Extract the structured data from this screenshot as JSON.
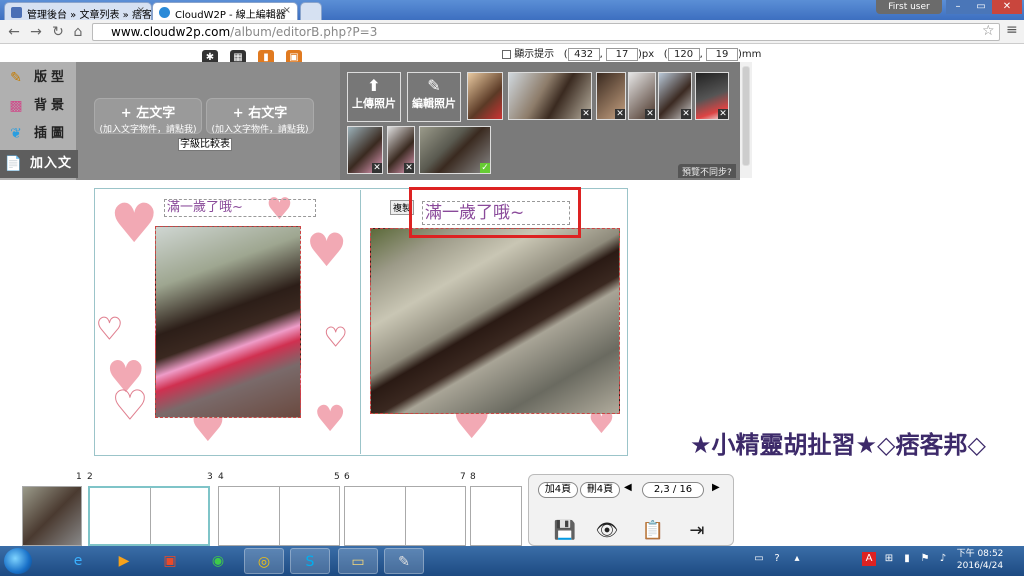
{
  "browser": {
    "tabs": [
      {
        "label": "管理後台 » 文章列表 » 痞客"
      },
      {
        "label": "CloudW2P - 線上編輯器"
      }
    ],
    "user_label": "First user",
    "address": {
      "host": "www.cloudw2p.com",
      "path": "/album/editorB.php?P=3"
    }
  },
  "toolbar": {
    "hint_label": "顯示提示",
    "pos_x": "432",
    "pos_y": "17",
    "px_unit": ")px",
    "size_w": "120",
    "size_h": "19",
    "mm_unit": ")mm"
  },
  "leftmenu": {
    "items": [
      {
        "label": "版型",
        "icon": "layout-icon"
      },
      {
        "label": "背景",
        "icon": "background-icon"
      },
      {
        "label": "插圖",
        "icon": "clipart-icon"
      },
      {
        "label": "加入文字",
        "icon": "text-icon"
      }
    ]
  },
  "text_buttons": {
    "left": {
      "title": "+ 左文字",
      "sub": "(加入文字物件，請點我)"
    },
    "right": {
      "title": "+ 右文字",
      "sub": "(加入文字物件，請點我)"
    },
    "size_table": "字級比較表"
  },
  "photo_panel": {
    "upload": "上傳照片",
    "edit": "編輯照片",
    "preview_mismatch": "預覽不同步?"
  },
  "spread": {
    "left_text": "滿一歲了哦~",
    "right_text": "滿一歲了哦~",
    "copy": "複製"
  },
  "watermark": "★小精靈胡扯習★◇痞客邦◇",
  "pages": {
    "numbers": [
      "1",
      "2",
      "3",
      "4",
      "5",
      "6",
      "7",
      "8"
    ]
  },
  "controls": {
    "add_pages": "加4頁",
    "delete_pages": "刪4頁",
    "page_indicator": "2,3 / 16"
  },
  "taskbar": {
    "time": "下午 08:52",
    "date": "2016/4/24"
  }
}
